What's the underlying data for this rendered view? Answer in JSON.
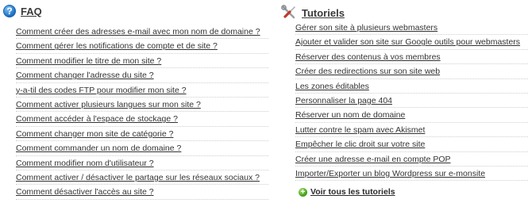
{
  "faq": {
    "title": "FAQ",
    "items": [
      "Comment créer des adresses e-mail avec mon nom de domaine ?",
      "Comment gérer les notifications de compte et de site ?",
      "Comment modifier le titre de mon site ?",
      "Comment changer l'adresse du site ?",
      "y-a-til des codes FTP pour modifier mon site ?",
      "Comment activer plusieurs langues sur mon site ?",
      "Comment accéder à l'espace de stockage ?",
      "Comment changer mon site de catégorie ?",
      "Comment commander un nom de domaine ?",
      "Comment modifier nom d'utilisateur ?",
      "Comment activer / désactiver le partage sur les réseaux sociaux ?",
      "Comment désactiver l'accès au site ?"
    ]
  },
  "tutorials": {
    "title": "Tutoriels",
    "items": [
      "Gérer son site à plusieurs webmasters",
      "Ajouter et valider son site sur Google outils pour webmasters",
      "Réserver des contenus à vos membres",
      "Créer des redirections sur son site web",
      "Les zones éditables",
      "Personnaliser la page 404",
      "Réserver un nom de domaine",
      "Lutter contre le spam avec Akismet",
      "Empêcher le clic droit sur votre site",
      "Créer une adresse e-mail en compte POP",
      "Importer/Exporter un blog Wordpress sur e-monsite"
    ],
    "see_all": "Voir tous les tutoriels"
  },
  "icons": {
    "faq": "help-question-icon",
    "tutorials": "tools-icon",
    "see_all": "plus-circle-icon"
  },
  "colors": {
    "text": "#333333",
    "faq_icon": "#1b6fc4",
    "plus_icon": "#3e9a1b"
  }
}
